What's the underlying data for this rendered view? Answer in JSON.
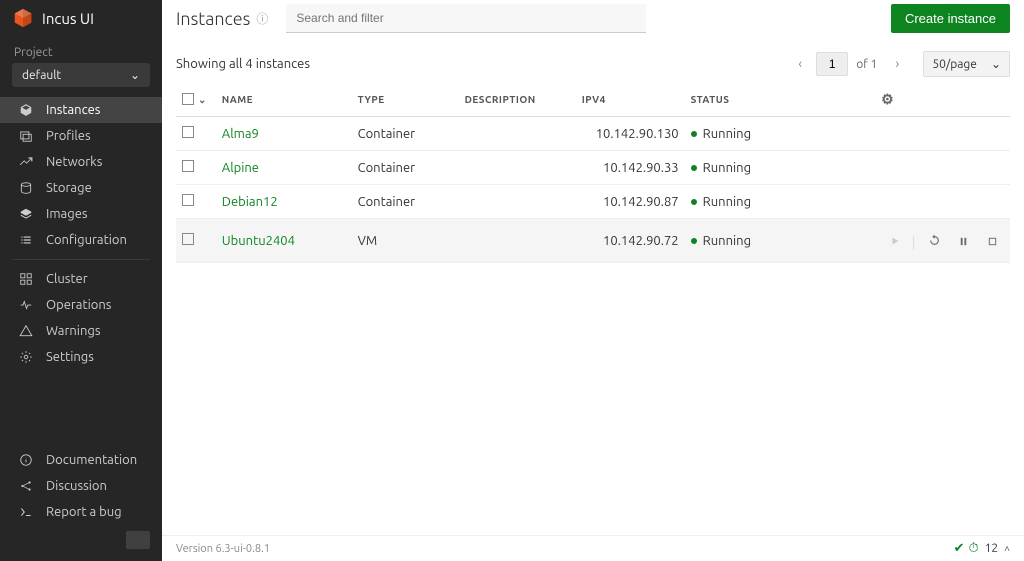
{
  "app": {
    "title": "Incus UI"
  },
  "sidebar": {
    "projectLabel": "Project",
    "projectValue": "default",
    "nav": [
      {
        "label": "Instances",
        "icon": "cube"
      },
      {
        "label": "Profiles",
        "icon": "cards"
      },
      {
        "label": "Networks",
        "icon": "network"
      },
      {
        "label": "Storage",
        "icon": "disk"
      },
      {
        "label": "Images",
        "icon": "layers"
      },
      {
        "label": "Configuration",
        "icon": "list"
      }
    ],
    "nav2": [
      {
        "label": "Cluster",
        "icon": "grid"
      },
      {
        "label": "Operations",
        "icon": "pulse"
      },
      {
        "label": "Warnings",
        "icon": "warning"
      },
      {
        "label": "Settings",
        "icon": "gear"
      }
    ],
    "footer": [
      {
        "label": "Documentation",
        "icon": "info"
      },
      {
        "label": "Discussion",
        "icon": "share"
      },
      {
        "label": "Report a bug",
        "icon": "terminal"
      }
    ]
  },
  "page": {
    "title": "Instances",
    "searchPlaceholder": "Search and filter",
    "createLabel": "Create instance",
    "showing": "Showing all 4 instances",
    "pager": {
      "page": "1",
      "of": "of 1",
      "perPage": "50/page"
    }
  },
  "table": {
    "columns": {
      "name": "NAME",
      "type": "TYPE",
      "description": "DESCRIPTION",
      "ipv4": "IPV4",
      "status": "STATUS"
    },
    "rows": [
      {
        "name": "Alma9",
        "type": "Container",
        "description": "",
        "ipv4": "10.142.90.130",
        "status": "Running"
      },
      {
        "name": "Alpine",
        "type": "Container",
        "description": "",
        "ipv4": "10.142.90.33",
        "status": "Running"
      },
      {
        "name": "Debian12",
        "type": "Container",
        "description": "",
        "ipv4": "10.142.90.87",
        "status": "Running"
      },
      {
        "name": "Ubuntu2404",
        "type": "VM",
        "description": "",
        "ipv4": "10.142.90.72",
        "status": "Running"
      }
    ]
  },
  "footer": {
    "version": "Version 6.3-ui-0.8.1",
    "statusCount": "12"
  }
}
